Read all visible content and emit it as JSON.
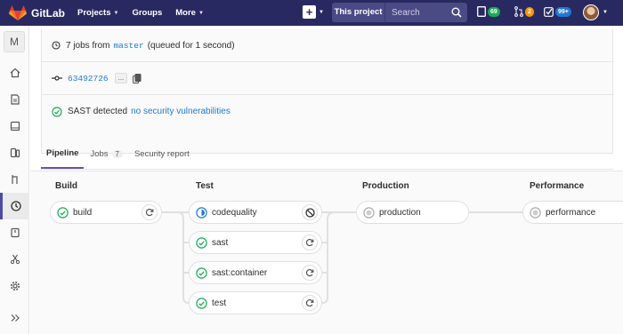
{
  "navbar": {
    "brand": "GitLab",
    "menu": [
      {
        "label": "Projects"
      },
      {
        "label": "Groups"
      },
      {
        "label": "More"
      }
    ],
    "search_scope": "This project",
    "search_placeholder": "Search",
    "counters": [
      {
        "icon": "todo-list-icon",
        "count": "69",
        "color": "#1aaa55"
      },
      {
        "icon": "merge-request-icon",
        "count": "2",
        "color": "#fc9403"
      },
      {
        "icon": "issues-check-icon",
        "count": "99+",
        "color": "#1f78d1"
      }
    ]
  },
  "sidebar": {
    "project_initial": "M",
    "items": [
      {
        "icon": "home-icon"
      },
      {
        "icon": "repository-icon"
      },
      {
        "icon": "issues-icon"
      },
      {
        "icon": "merge-requests-icon"
      },
      {
        "icon": "branch-icon"
      },
      {
        "icon": "ci-cd-icon",
        "active": true
      },
      {
        "icon": "operations-icon"
      },
      {
        "icon": "snippets-icon"
      },
      {
        "icon": "settings-icon"
      },
      {
        "icon": "collapse-sidebar-icon"
      }
    ]
  },
  "pipeline_info": {
    "jobs_text_prefix": "7 jobs from",
    "branch": "master",
    "jobs_text_suffix": "(queued for 1 second)",
    "commit_sha": "63492726",
    "ellipsis": "...",
    "sast_text": "SAST detected",
    "sast_link": "no security vulnerabilities"
  },
  "tabs": [
    {
      "label": "Pipeline",
      "active": true
    },
    {
      "label": "Jobs",
      "count": "7"
    },
    {
      "label": "Security report"
    }
  ],
  "stages": [
    {
      "name": "Build",
      "jobs": [
        {
          "name": "build",
          "status": "success",
          "action": "retry"
        }
      ]
    },
    {
      "name": "Test",
      "jobs": [
        {
          "name": "codequality",
          "status": "running",
          "action": "cancel"
        },
        {
          "name": "sast",
          "status": "success",
          "action": "retry"
        },
        {
          "name": "sast:container",
          "status": "success",
          "action": "retry"
        },
        {
          "name": "test",
          "status": "success",
          "action": "retry"
        }
      ]
    },
    {
      "name": "Production",
      "jobs": [
        {
          "name": "production",
          "status": "manual",
          "action": "none"
        }
      ]
    },
    {
      "name": "Performance",
      "jobs": [
        {
          "name": "performance",
          "status": "manual",
          "action": "none"
        }
      ]
    }
  ],
  "colors": {
    "navbar": "#292961",
    "success": "#1aaa55",
    "running": "#1f78d1",
    "manual": "#aaaaaa",
    "tab_active": "#6b4fbb"
  }
}
